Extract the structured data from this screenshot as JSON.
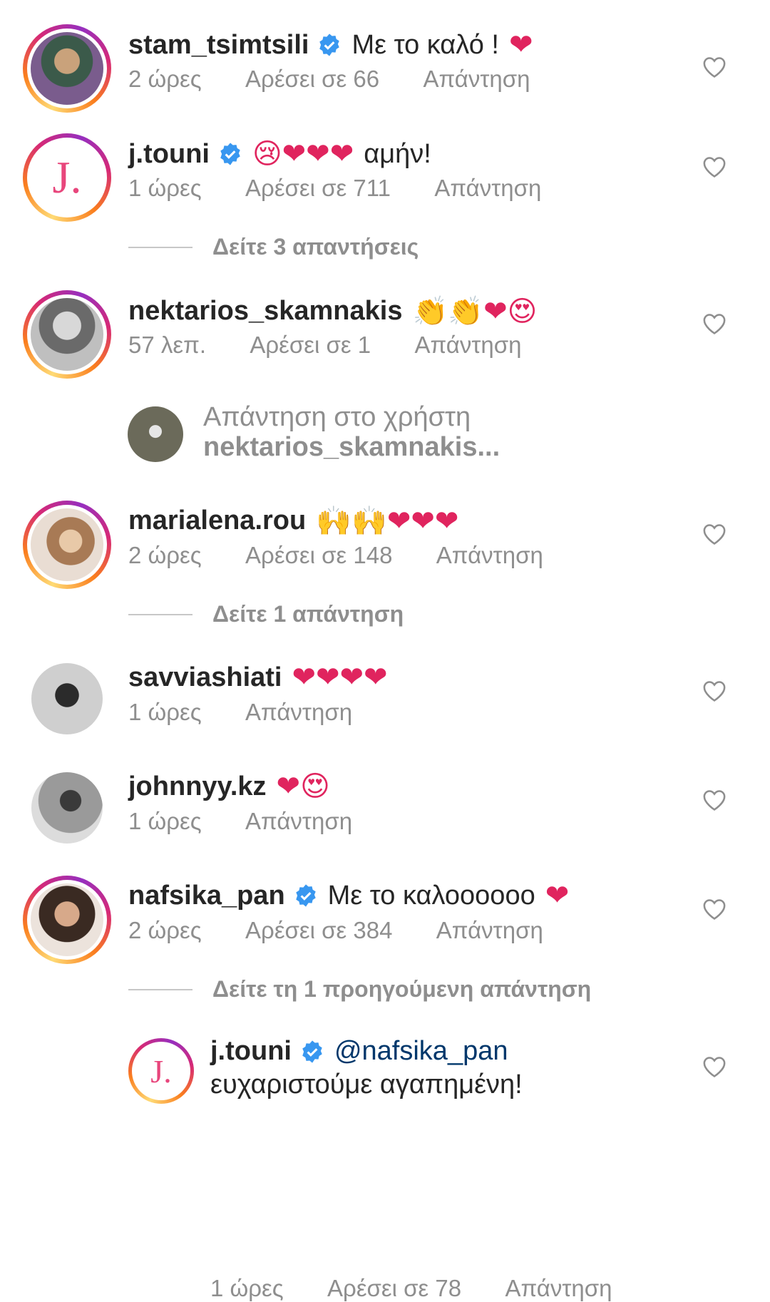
{
  "comments": [
    {
      "username": "stam_tsimtsili",
      "verified": true,
      "text": "Με το καλό !",
      "emoji": "❤",
      "time": "2 ώρες",
      "likes": "Αρέσει σε 66",
      "reply": "Απάντηση"
    },
    {
      "username": "j.touni",
      "verified": true,
      "emoji_pre": "😢❤❤❤",
      "text": "αμήν!",
      "time": "1 ώρες",
      "likes": "Αρέσει σε 711",
      "reply": "Απάντηση",
      "view_replies": "Δείτε 3 απαντήσεις"
    },
    {
      "username": "nektarios_skamnakis",
      "verified": false,
      "emoji": "👏👏❤😍",
      "time": "57 λεπ.",
      "likes": "Αρέσει σε 1",
      "reply": "Απάντηση"
    },
    {
      "username": "marialena.rou",
      "verified": false,
      "emoji": "🙌🙌❤❤❤",
      "time": "2 ώρες",
      "likes": "Αρέσει σε 148",
      "reply": "Απάντηση",
      "view_replies": "Δείτε 1 απάντηση"
    },
    {
      "username": "savviashiati",
      "verified": false,
      "emoji": "❤❤❤❤",
      "time": "1 ώρες",
      "reply": "Απάντηση"
    },
    {
      "username": "johnnyy.kz",
      "verified": false,
      "emoji": "❤😍",
      "time": "1 ώρες",
      "reply": "Απάντηση"
    },
    {
      "username": "nafsika_pan",
      "verified": true,
      "text": "Με το καλοοοοοο",
      "emoji": "❤",
      "time": "2 ώρες",
      "likes": "Αρέσει σε 384",
      "reply": "Απάντηση",
      "view_replies": "Δείτε τη 1 προηγούμενη απάντηση"
    },
    {
      "username": "j.touni",
      "verified": true,
      "mention": "@nafsika_pan",
      "text": "ευχαριστούμε αγαπημένη!",
      "time": "1 ώρες",
      "likes": "Αρέσει σε 78",
      "reply": "Απάντηση"
    }
  ],
  "reply_to": {
    "label": "Απάντηση στο χρήστη",
    "user": "nektarios_skamnakis..."
  },
  "avatar_logo": "J.",
  "colors": {
    "verified": "#3897f0",
    "heart": "#e0245e",
    "meta": "#8e8e8e",
    "mention": "#00376b"
  },
  "icons": {
    "like": "heart-outline-icon",
    "verified": "verified-badge-icon"
  }
}
